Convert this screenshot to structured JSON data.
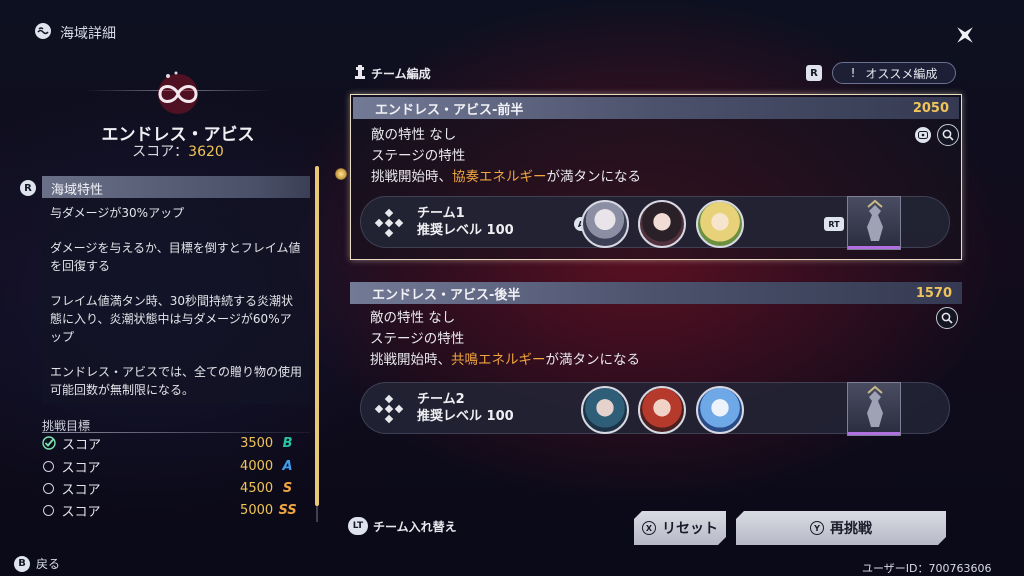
{
  "header": {
    "icon": "sea-area-icon",
    "title": "海域詳細"
  },
  "area": {
    "name": "エンドレス・アビス",
    "score_label": "スコア：",
    "score_value": "3620"
  },
  "feature": {
    "badge": "R",
    "heading": "海域特性",
    "paragraphs": [
      "与ダメージが30%アップ",
      "ダメージを与えるか、目標を倒すとフレイム値を回復する",
      "フレイム値満タン時、30秒間持続する炎潮状態に入り、炎潮状態中は与ダメージが60%アップ",
      "エンドレス・アビスでは、全ての贈り物の使用可能回数が無制限になる。"
    ]
  },
  "goals": {
    "heading": "挑戦目標",
    "rows": [
      {
        "label": "スコア",
        "value": "3500",
        "rank": "B",
        "rank_color": "#27c2a2",
        "done": true
      },
      {
        "label": "スコア",
        "value": "4000",
        "rank": "A",
        "rank_color": "#3f9ef0",
        "done": false
      },
      {
        "label": "スコア",
        "value": "4500",
        "rank": "S",
        "rank_color": "#f0a540",
        "done": false
      },
      {
        "label": "スコア",
        "value": "5000",
        "rank": "SS",
        "rank_color": "#f0a540",
        "done": false
      }
    ]
  },
  "back": {
    "key": "B",
    "label": "戻る"
  },
  "team_section": {
    "title": "チーム編成",
    "rec_key": "R",
    "rec_icon": "!",
    "rec_label": "オススメ編成"
  },
  "stages": [
    {
      "name": "エンドレス・アビス-前半",
      "score": "2050",
      "enemy": "敵の特性  なし",
      "stage_label": "ステージの特性",
      "effect_prefix": "挑戦開始時、",
      "effect_highlight": "協奏エネルギー",
      "effect_suffix": "が満タンになる",
      "team_name": "チーム1",
      "team_level": "推奨レベル 100",
      "avatar_badge": "A",
      "rt_badge": "RT"
    },
    {
      "name": "エンドレス・アビス-後半",
      "score": "1570",
      "enemy": "敵の特性  なし",
      "stage_label": "ステージの特性",
      "effect_prefix": "挑戦開始時、",
      "effect_highlight": "共鳴エネルギー",
      "effect_suffix": "が満タンになる",
      "team_name": "チーム2",
      "team_level": "推奨レベル 100"
    }
  ],
  "bottom": {
    "swap_key": "LT",
    "swap_label": "チーム入れ替え",
    "reset_key": "X",
    "reset_label": "リセット",
    "retry_key": "Y",
    "retry_label": "再挑戦",
    "user_id": "ユーザーID：700763606"
  },
  "colors": {
    "accent_gold": "#f0c45a",
    "highlight_orange": "#f0a540"
  }
}
